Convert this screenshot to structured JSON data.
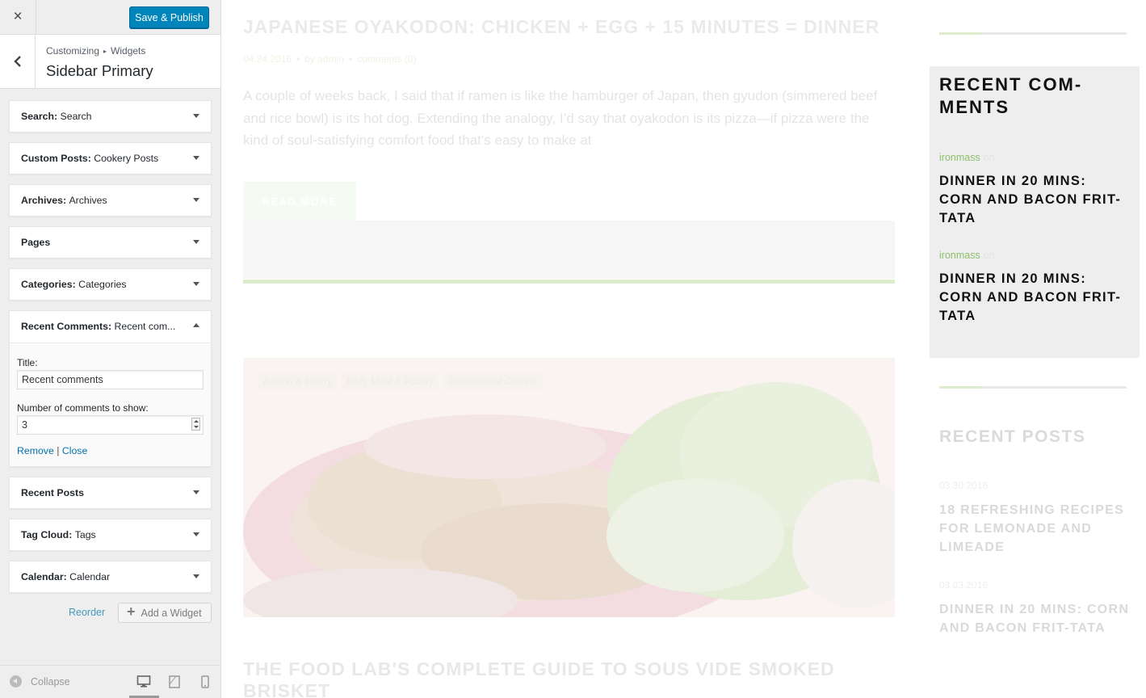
{
  "customizer": {
    "close_label": "×",
    "publish_label": "Save & Publish",
    "breadcrumb": {
      "root": "Customizing",
      "sep": "▸",
      "current": "Widgets"
    },
    "section_title": "Sidebar Primary",
    "widgets": [
      {
        "type": "Search",
        "title": "Search"
      },
      {
        "type": "Custom Posts",
        "title": "Cookery Posts"
      },
      {
        "type": "Archives",
        "title": "Archives"
      },
      {
        "type": "Pages",
        "title": ""
      },
      {
        "type": "Categories",
        "title": "Categories"
      }
    ],
    "open_widget": {
      "type": "Recent Comments",
      "title": "Recent com...",
      "title_label": "Title:",
      "title_value": "Recent comments",
      "number_label": "Number of comments to show:",
      "number_value": "3",
      "remove_label": "Remove",
      "sep": "|",
      "close_label": "Close"
    },
    "widgets_after": [
      {
        "type": "Recent Posts",
        "title": ""
      },
      {
        "type": "Tag Cloud",
        "title": "Tags"
      },
      {
        "type": "Calendar",
        "title": "Calendar"
      }
    ],
    "reorder_label": "Reorder",
    "add_widget_label": "Add a Widget",
    "collapse_label": "Collapse",
    "devices": [
      "desktop-icon",
      "tablet-icon",
      "mobile-icon"
    ]
  },
  "preview": {
    "post1": {
      "title": "JAPANESE OYAKODON: CHICKEN + EGG + 15 MINUTES = DINNER",
      "date": "04.24.2016",
      "author": "by admin",
      "comments": "comments (0)",
      "excerpt": "A couple of weeks back, I said that if ramen is like the hamburger of Japan, then gyudon (simmered beef and rice bowl) is its hot dog. Extending the analogy, I’d say that oyakodon is its pizza—if pizza were the kind of soul-satisfying comfort food that’s easy to make at",
      "read_more": "READ MORE"
    },
    "post2": {
      "tags": [
        "Baking & Pastry",
        "Fish, Meat & Poultry",
        "International Cuisine"
      ],
      "title": "THE FOOD LAB'S COMPLETE GUIDE TO SOUS VIDE SMOKED BRISKET"
    },
    "recent_comments": {
      "title": "RECENT COM-MENTS",
      "items": [
        {
          "author": "ironmass",
          "on": "on",
          "post": "DINNER IN 20 MINS: CORN AND BACON FRIT-TATA"
        },
        {
          "author": "ironmass",
          "on": "on",
          "post": "DINNER IN 20 MINS: CORN AND BACON FRIT-TATA"
        }
      ]
    },
    "recent_posts": {
      "title": "RECENT POSTS",
      "items": [
        {
          "date": "03.30.2016",
          "title": "18 REFRESHING RECIPES FOR LEMONADE AND LIMEADE"
        },
        {
          "date": "03.03.2016",
          "title": "DINNER IN 20 MINS: CORN AND BACON FRIT-TATA"
        }
      ]
    },
    "accent_color": "#8ec06c"
  }
}
